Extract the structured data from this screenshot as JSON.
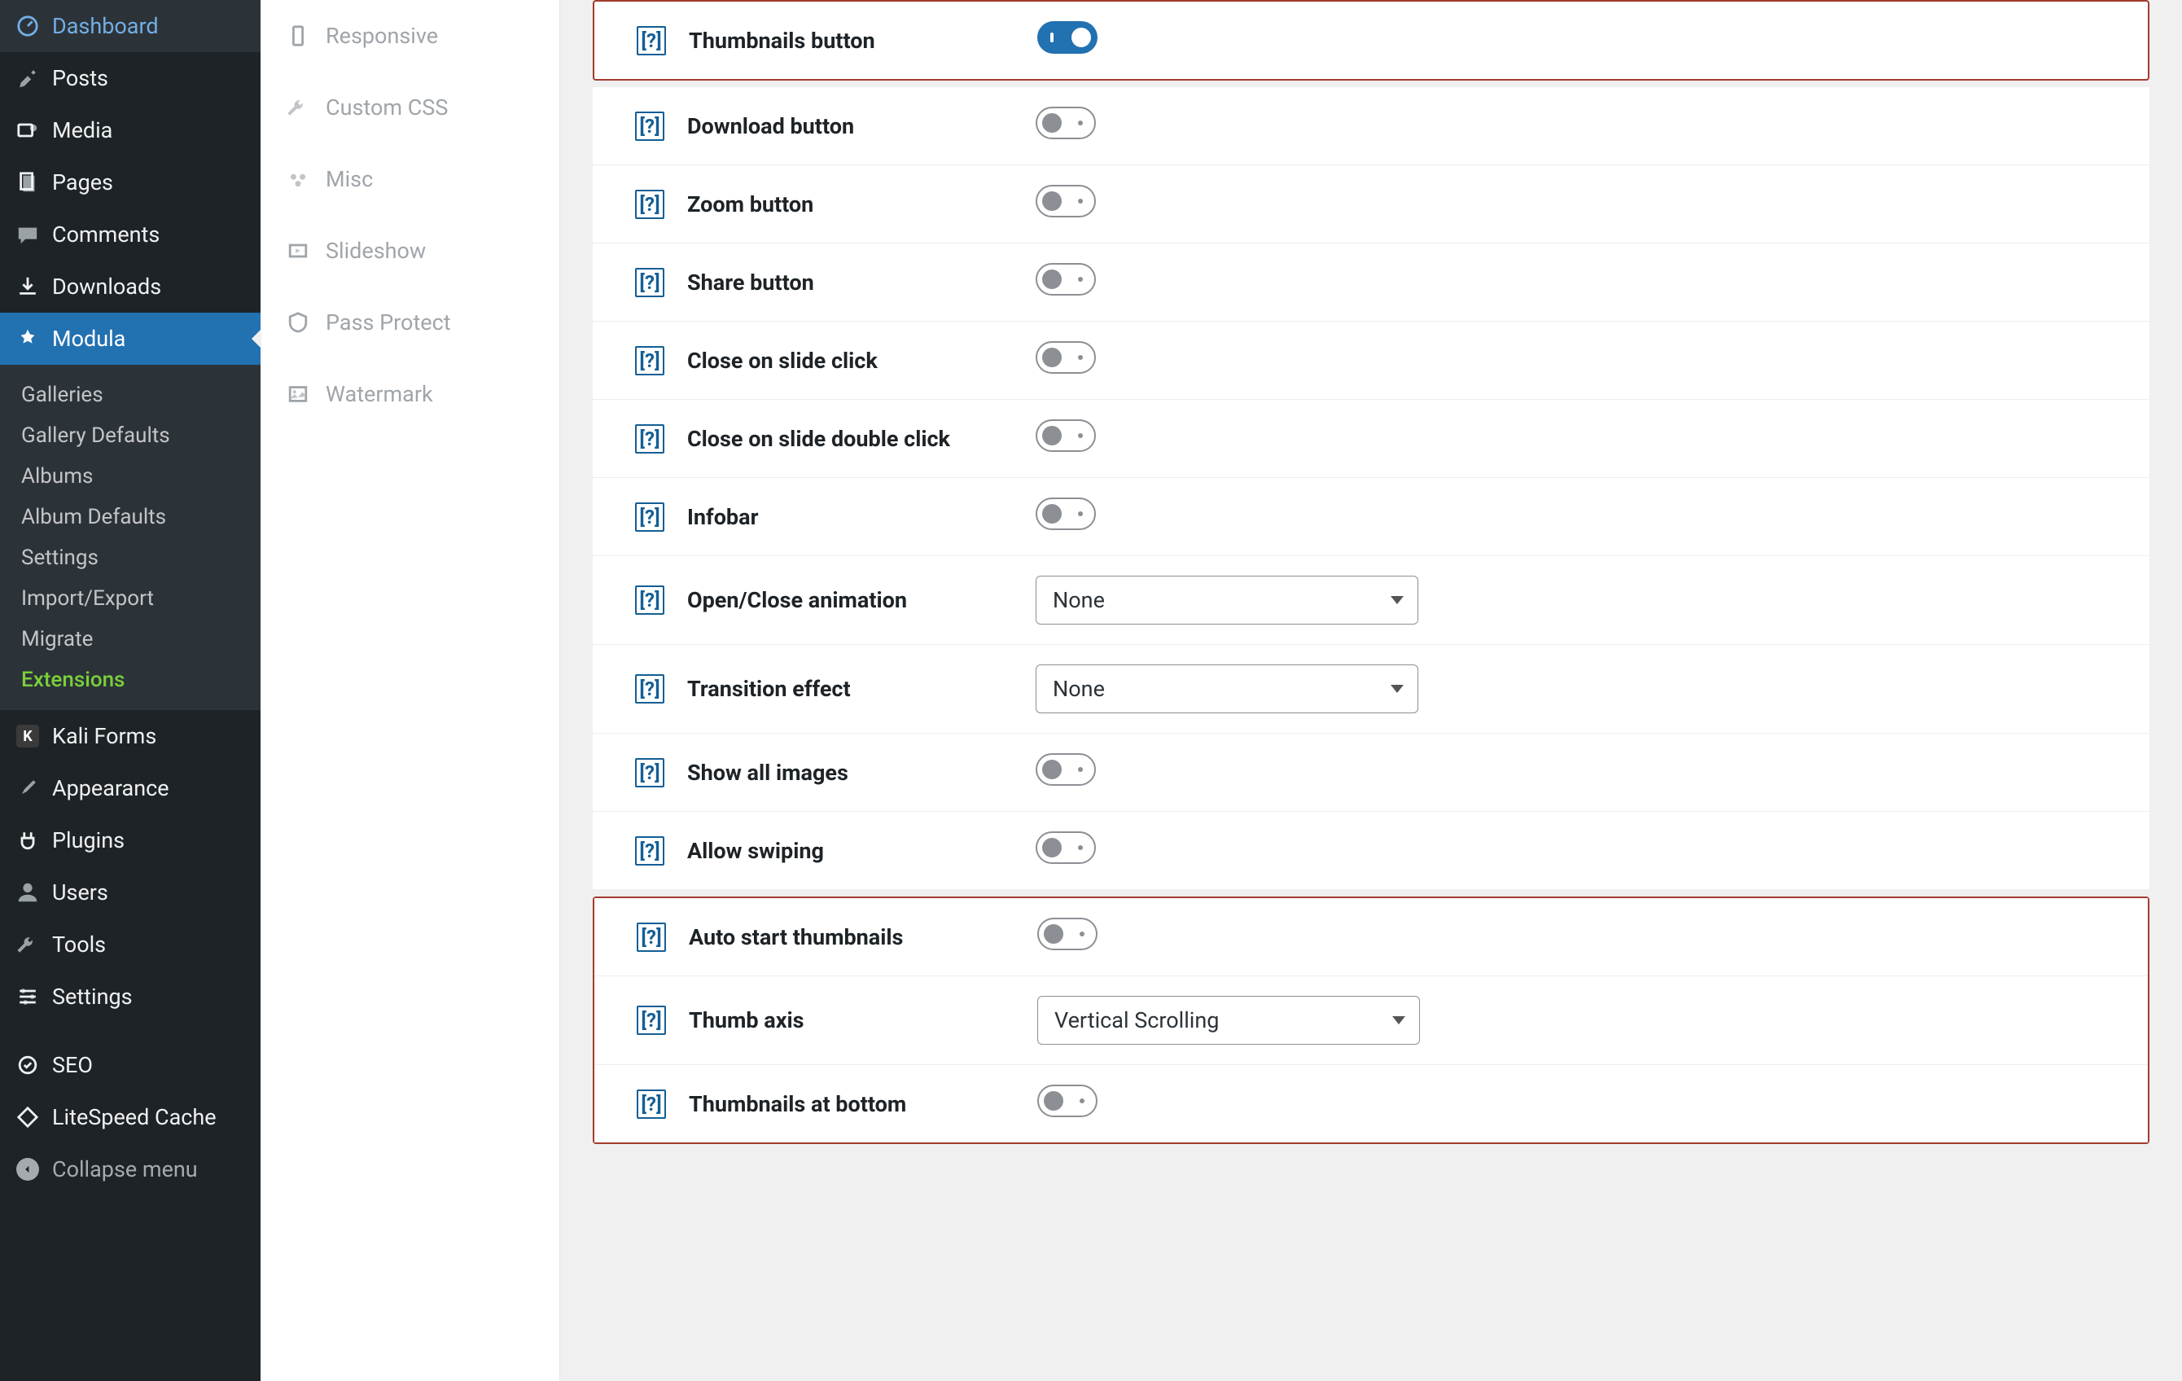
{
  "sidebar": {
    "items": [
      {
        "label": "Dashboard",
        "icon": "dashboard"
      },
      {
        "label": "Posts",
        "icon": "pin"
      },
      {
        "label": "Media",
        "icon": "media"
      },
      {
        "label": "Pages",
        "icon": "pages"
      },
      {
        "label": "Comments",
        "icon": "comment"
      },
      {
        "label": "Downloads",
        "icon": "download"
      },
      {
        "label": "Modula",
        "icon": "gear-star",
        "active": true
      },
      {
        "label": "Kali Forms",
        "icon": "k"
      },
      {
        "label": "Appearance",
        "icon": "brush"
      },
      {
        "label": "Plugins",
        "icon": "plug"
      },
      {
        "label": "Users",
        "icon": "user"
      },
      {
        "label": "Tools",
        "icon": "wrench"
      },
      {
        "label": "Settings",
        "icon": "sliders"
      },
      {
        "label": "SEO",
        "icon": "seo"
      },
      {
        "label": "LiteSpeed Cache",
        "icon": "diamond"
      }
    ],
    "submenu": [
      {
        "label": "Galleries"
      },
      {
        "label": "Gallery Defaults"
      },
      {
        "label": "Albums"
      },
      {
        "label": "Album Defaults"
      },
      {
        "label": "Settings"
      },
      {
        "label": "Import/Export"
      },
      {
        "label": "Migrate"
      },
      {
        "label": "Extensions",
        "active": true
      }
    ],
    "collapse_label": "Collapse menu"
  },
  "tabs": [
    {
      "label": "Responsive",
      "icon": "phone"
    },
    {
      "label": "Custom CSS",
      "icon": "wrench"
    },
    {
      "label": "Misc",
      "icon": "dots"
    },
    {
      "label": "Slideshow",
      "icon": "slideshow"
    },
    {
      "label": "Pass Protect",
      "icon": "shield"
    },
    {
      "label": "Watermark",
      "icon": "image"
    }
  ],
  "settings": {
    "help_glyph": "[?]",
    "rows": [
      {
        "label": "Thumbnails button",
        "type": "toggle",
        "value": true,
        "highlight": "single"
      },
      {
        "label": "Download button",
        "type": "toggle",
        "value": false
      },
      {
        "label": "Zoom button",
        "type": "toggle",
        "value": false
      },
      {
        "label": "Share button",
        "type": "toggle",
        "value": false
      },
      {
        "label": "Close on slide click",
        "type": "toggle",
        "value": false
      },
      {
        "label": "Close on slide double click",
        "type": "toggle",
        "value": false
      },
      {
        "label": "Infobar",
        "type": "toggle",
        "value": false
      },
      {
        "label": "Open/Close animation",
        "type": "select",
        "value": "None"
      },
      {
        "label": "Transition effect",
        "type": "select",
        "value": "None"
      },
      {
        "label": "Show all images",
        "type": "toggle",
        "value": false
      },
      {
        "label": "Allow swiping",
        "type": "toggle",
        "value": false
      },
      {
        "label": "Auto start thumbnails",
        "type": "toggle",
        "value": false,
        "highlight": "group-start"
      },
      {
        "label": "Thumb axis",
        "type": "select",
        "value": "Vertical Scrolling",
        "highlight": "group"
      },
      {
        "label": "Thumbnails at bottom",
        "type": "toggle",
        "value": false,
        "highlight": "group-end"
      }
    ]
  }
}
